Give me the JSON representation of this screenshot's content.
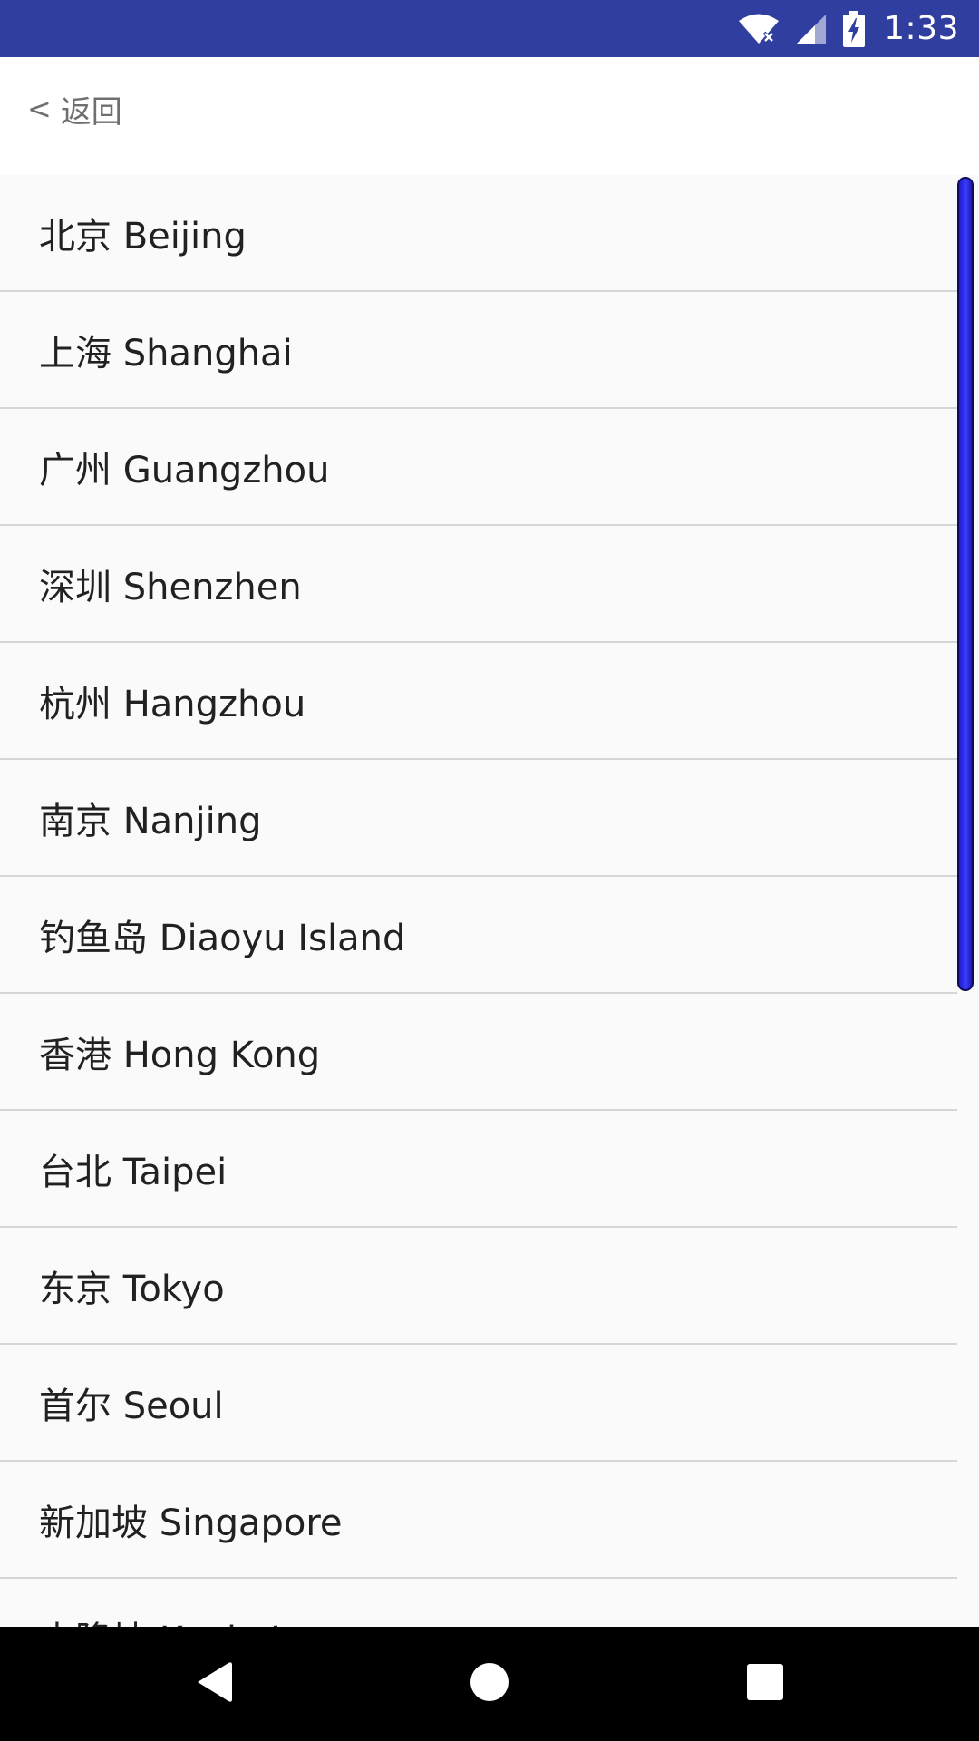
{
  "status_bar": {
    "time": "1:33",
    "icons": [
      "wifi-icon",
      "cellular-signal-icon",
      "battery-charging-icon"
    ]
  },
  "header": {
    "back_chevron": "<",
    "back_label": "返回"
  },
  "city_list": {
    "items": [
      {
        "label": "北京 Beijing"
      },
      {
        "label": "上海 Shanghai"
      },
      {
        "label": "广州 Guangzhou"
      },
      {
        "label": "深圳 Shenzhen"
      },
      {
        "label": "杭州 Hangzhou"
      },
      {
        "label": "南京 Nanjing"
      },
      {
        "label": "钓鱼岛 Diaoyu Island"
      },
      {
        "label": "香港 Hong Kong"
      },
      {
        "label": "台北 Taipei"
      },
      {
        "label": "东京 Tokyo"
      },
      {
        "label": "首尔 Seoul"
      },
      {
        "label": "新加坡 Singapore"
      },
      {
        "label": "吉隆坡 Kuala Lumpur"
      }
    ]
  },
  "nav_bar": {
    "icons": [
      "back-triangle-icon",
      "home-circle-icon",
      "recents-square-icon"
    ]
  },
  "colors": {
    "status_bar": "#303f9f",
    "list_background": "#fafafa",
    "divider": "#d6d6d6",
    "scrollbar": "#3a3aff",
    "nav_bar": "#000000"
  }
}
